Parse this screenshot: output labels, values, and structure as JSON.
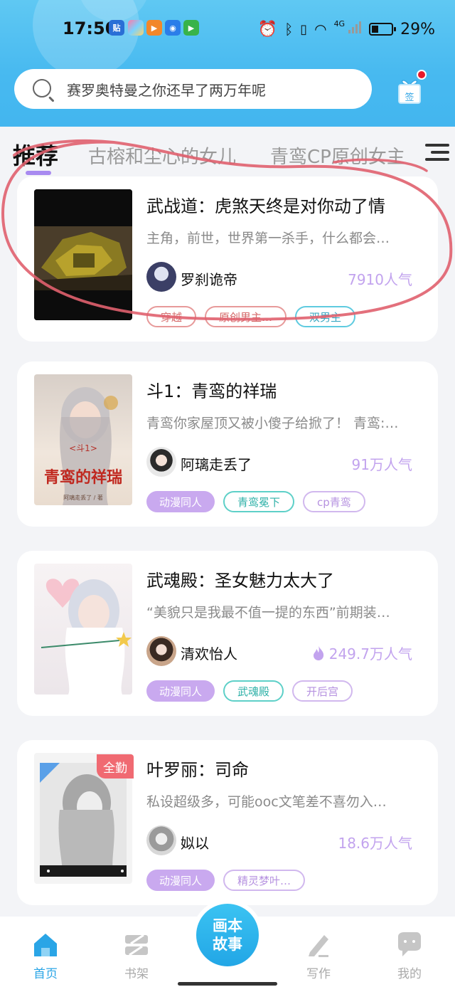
{
  "status_bar": {
    "time": "17:50",
    "battery": "29%",
    "network": "4G",
    "notif_apps": [
      "贴",
      "",
      "",
      "",
      ""
    ]
  },
  "search": {
    "placeholder": "赛罗奥特曼之你还早了两万年呢"
  },
  "sign_in": {
    "label": "签"
  },
  "tabs": {
    "active": "推荐",
    "items": [
      "古榕和尘心的女儿",
      "青鸾CP原创女主"
    ]
  },
  "books": [
    {
      "title": "武战道：虎煞天终是对你动了情",
      "desc": "主角，前世，世界第一杀手，什么都会…",
      "author": "罗刹诡帝",
      "popularity": "7910人气",
      "tags": [
        "穿越",
        "原创男主…",
        "双男主"
      ]
    },
    {
      "title": "斗1：青鸾的祥瑞",
      "desc": "青鸾你家屋顶又被小傻子给掀了！ 青鸾:…",
      "author": "阿璃走丢了",
      "popularity": "91万人气",
      "tags": [
        "动漫同人",
        "青鸾冕下",
        "cp青鸾"
      ],
      "cover_text": "<斗1>",
      "cover_title": "青鸾的祥瑞",
      "cover_author": "阿璃走丢了 / 著"
    },
    {
      "title": "武魂殿：圣女魅力太大了",
      "desc": "“美貌只是我最不值一提的东西”前期装…",
      "author": "清欢怡人",
      "popularity": "249.7万人气",
      "tags": [
        "动漫同人",
        "武魂殿",
        "开后宫"
      ]
    },
    {
      "title": "叶罗丽：司命",
      "desc": "私设超级多，可能ooc文笔差不喜勿入…",
      "author": "姒以",
      "popularity": "18.6万人气",
      "tags": [
        "动漫同人",
        "精灵梦叶…"
      ],
      "badge": "全勤"
    }
  ],
  "nav": {
    "home": "首页",
    "shelf": "书架",
    "center_line1": "画本",
    "center_line2": "故事",
    "write": "写作",
    "me": "我的"
  },
  "colors": {
    "header_blue": "#47b9f0",
    "accent_purple": "#c2a3ee",
    "nav_active": "#2aa5e6",
    "annotation_red": "#e0606e"
  }
}
